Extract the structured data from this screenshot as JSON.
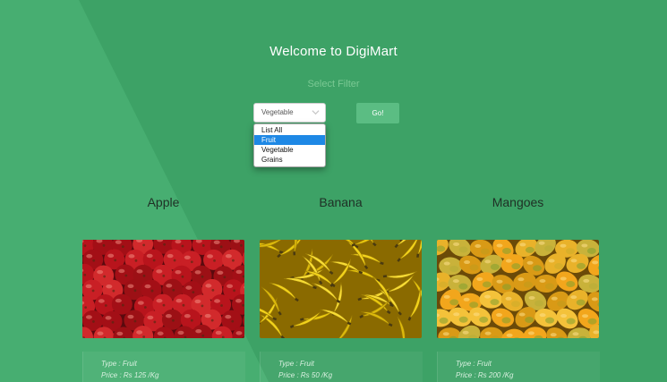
{
  "header": {
    "title": "Welcome to DigiMart",
    "filter_label": "Select Filter"
  },
  "filter": {
    "selected": "Vegetable",
    "options": [
      "List All",
      "Fruit",
      "Vegetable",
      "Grains"
    ],
    "highlighted": "Fruit",
    "go_label": "Go!"
  },
  "products": [
    {
      "name": "Apple",
      "type": "Type : Fruit",
      "price": "Price : Rs 125 /Kg"
    },
    {
      "name": "Banana",
      "type": "Type : Fruit",
      "price": "Price : Rs 50 /Kg"
    },
    {
      "name": "Mangoes",
      "type": "Type : Fruit",
      "price": "Price : Rs 200 /Kg"
    }
  ],
  "colors": {
    "background": "#41a96b",
    "button": "#5bbd83",
    "dropdown_highlight": "#1e88e5"
  }
}
